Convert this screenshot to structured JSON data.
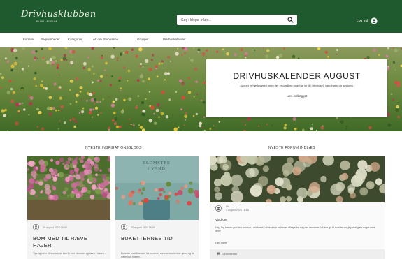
{
  "header": {
    "logo_text": "Drivhusklubben",
    "logo_sub": "BLOG · FORUM",
    "search_placeholder": "Søg i blogs, tråde...",
    "login_label": "Log ind"
  },
  "nav": {
    "items": [
      "Forside",
      "Begivenheder",
      "Kategorier",
      "Alt om drivhusene",
      "Grupper",
      "Drivhuskalender"
    ]
  },
  "hero": {
    "title": "DRIVHUSKALENDER AUGUST",
    "text": "August er høstmåned, men der er også nu noget at se til i drivhuset, vandingen og gødning.",
    "link": "Læs indlægget"
  },
  "blog_section": {
    "title": "NYESTE INSPIRATIONSBLOGS",
    "cards": [
      {
        "date": "20 august 2024 06:00",
        "title": "BOM MED TIL RÆVE HAVER",
        "excerpt": "Tips og idéer til hvordan du kan få flere blomster og farver i haven..."
      },
      {
        "date": "20 august 2024 06:00",
        "title": "BUKETTERNES TID",
        "excerpt": "Buketter med blomster fra haven er sommerens bedste gave, og de bliver kun flottere..."
      }
    ]
  },
  "forum_section": {
    "title": "NYESTE FORUM INDLÆG",
    "post": {
      "author": "Lis",
      "date": "4 august 2024 15:18",
      "title": "Vindruer",
      "body": "Hej. Jeg har en god stor vindrue i drivhuset. Vindruerne er blevet dårlige for mig her i sommer. Vil den gå til nu eller om jeg skal gøre noget med den?",
      "read_more": "Læs mere",
      "footer": "1 kommentar"
    }
  },
  "colors": {
    "header_green": "#1f5a2f",
    "card_bg": "#f4f4f4"
  }
}
